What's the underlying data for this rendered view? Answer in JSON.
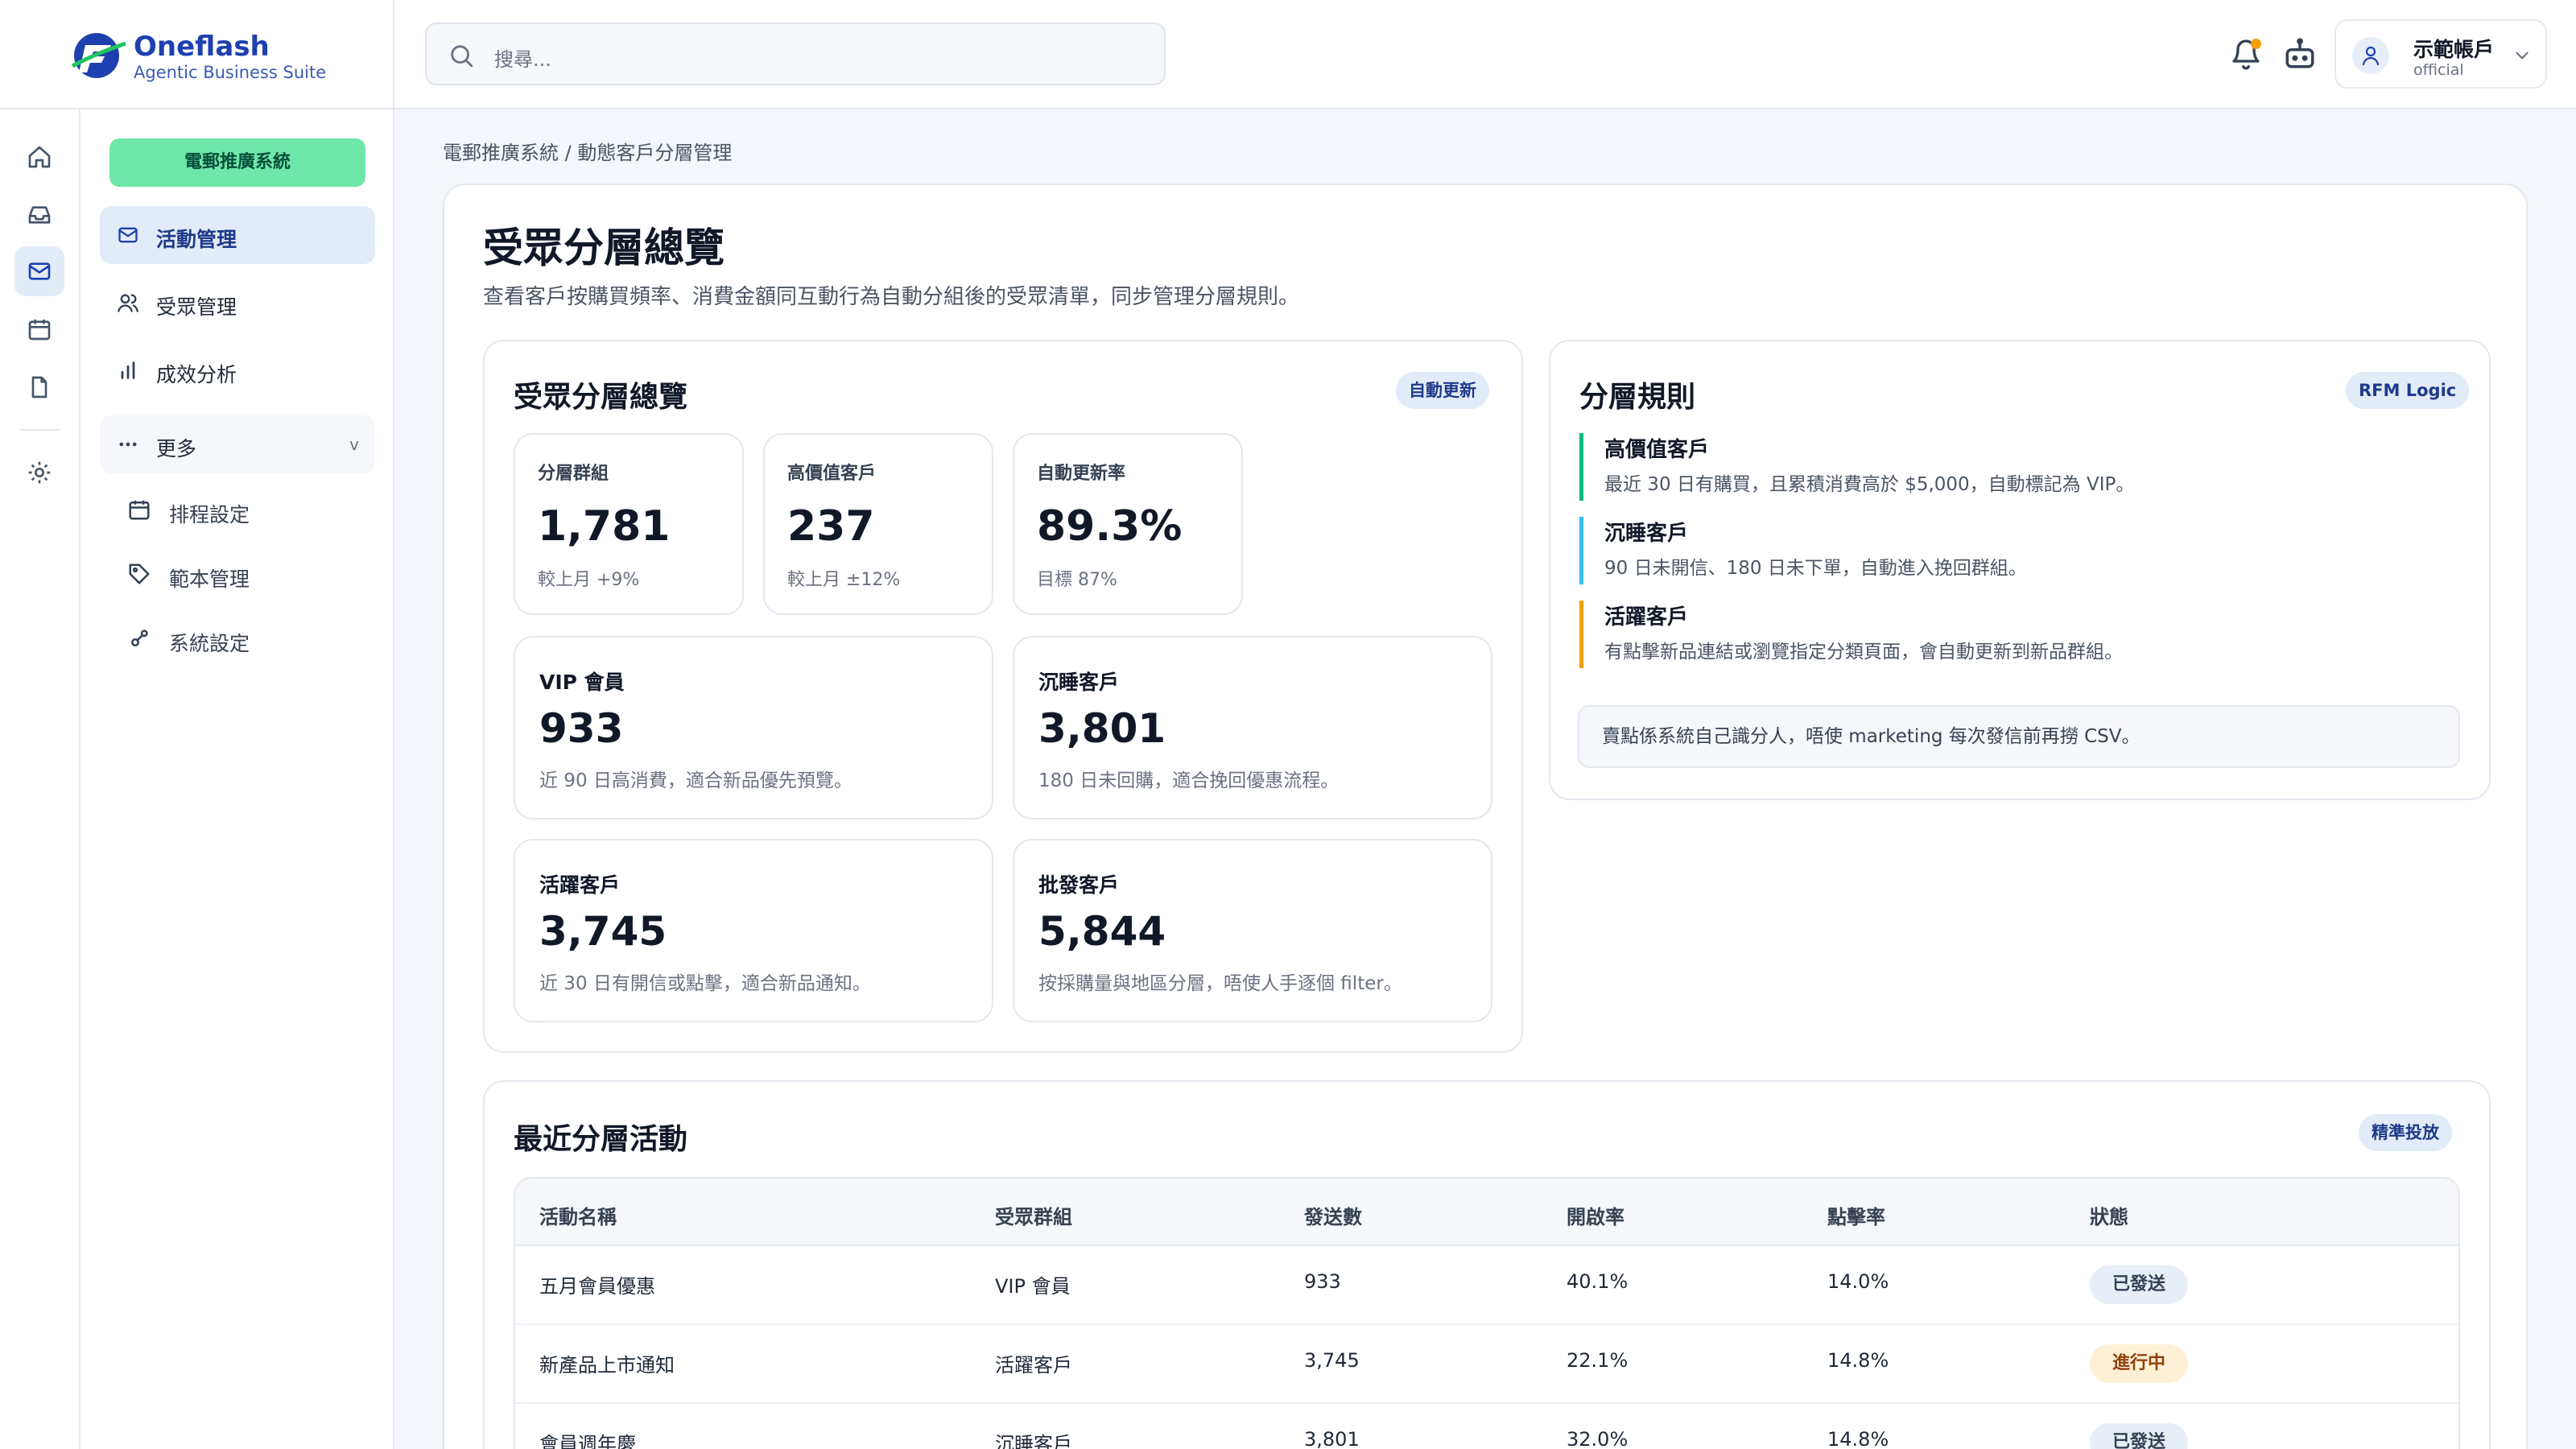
{
  "app": {
    "name": "Oneflash",
    "tagline": "Agentic Business Suite"
  },
  "search": {
    "placeholder": "搜尋..."
  },
  "account": {
    "name": "示範帳戶",
    "sub": "official"
  },
  "sidebar": {
    "cta": "電郵推廣系統",
    "items": [
      {
        "label": "活動管理",
        "icon": "mail-icon",
        "active": true
      },
      {
        "label": "受眾管理",
        "icon": "users-icon"
      },
      {
        "label": "成效分析",
        "icon": "bar-chart-icon"
      }
    ],
    "more": {
      "label": "更多",
      "chevron": "v"
    },
    "sub_items": [
      {
        "label": "排程設定",
        "icon": "calendar-icon"
      },
      {
        "label": "範本管理",
        "icon": "tag-icon"
      },
      {
        "label": "系統設定",
        "icon": "settings-icon"
      }
    ]
  },
  "breadcrumb": "電郵推廣系統 / 動態客戶分層管理",
  "page": {
    "title": "受眾分層總覽",
    "description": "查看客戶按購買頻率、消費金額同互動行為自動分組後的受眾清單，同步管理分層規則。"
  },
  "overview": {
    "title": "受眾分層總覽",
    "badge": "自動更新",
    "stats": [
      {
        "label": "分層群組",
        "value": "1,781",
        "note": "較上月 +9%"
      },
      {
        "label": "高價值客戶",
        "value": "237",
        "note": "較上月 ±12%"
      },
      {
        "label": "自動更新率",
        "value": "89.3%",
        "note": "目標 87%"
      }
    ],
    "segments": [
      {
        "label": "VIP 會員",
        "value": "933",
        "note": "近 90 日高消費，適合新品優先預覽。"
      },
      {
        "label": "沉睡客戶",
        "value": "3,801",
        "note": "180 日未回購，適合挽回優惠流程。"
      },
      {
        "label": "活躍客戶",
        "value": "3,745",
        "note": "近 30 日有開信或點擊，適合新品通知。"
      },
      {
        "label": "批發客戶",
        "value": "5,844",
        "note": "按採購量與地區分層，唔使人手逐個 filter。"
      }
    ]
  },
  "rules": {
    "title": "分層規則",
    "badge": "RFM Logic",
    "items": [
      {
        "name": "高價值客戶",
        "desc": "最近 30 日有購買，且累積消費高於 $5,000，自動標記為 VIP。",
        "color": "#10b981"
      },
      {
        "name": "沉睡客戶",
        "desc": "90 日未開信、180 日未下單，自動進入挽回群組。",
        "color": "#38bdf8"
      },
      {
        "name": "活躍客戶",
        "desc": "有點擊新品連結或瀏覽指定分類頁面，會自動更新到新品群組。",
        "color": "#f59e0b"
      }
    ],
    "note": "賣點係系統自己識分人，唔使 marketing 每次發信前再撈 CSV。"
  },
  "activity": {
    "title": "最近分層活動",
    "badge": "精準投放",
    "columns": [
      "活動名稱",
      "受眾群組",
      "發送數",
      "開啟率",
      "點擊率",
      "狀態"
    ],
    "rows": [
      {
        "name": "五月會員優惠",
        "group": "VIP 會員",
        "sent": "933",
        "open": "40.1%",
        "click": "14.0%",
        "status": "已發送"
      },
      {
        "name": "新產品上市通知",
        "group": "活躍客戶",
        "sent": "3,745",
        "open": "22.1%",
        "click": "14.8%",
        "status": "進行中"
      },
      {
        "name": "會員週年慶",
        "group": "沉睡客戶",
        "sent": "3,801",
        "open": "32.0%",
        "click": "14.8%",
        "status": "已發送"
      }
    ]
  }
}
